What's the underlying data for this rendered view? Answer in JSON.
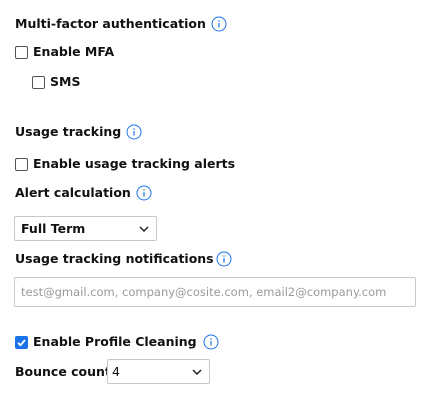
{
  "mfa": {
    "title": "Multi-factor authentication",
    "enable_label": "Enable MFA",
    "enable_checked": false,
    "sms_label": "SMS",
    "sms_checked": false
  },
  "usage": {
    "title": "Usage tracking",
    "alerts_label": "Enable usage tracking alerts",
    "alerts_checked": false,
    "alert_calc_label": "Alert calculation",
    "alert_calc_value": "Full Term",
    "notifications_label": "Usage tracking notifications",
    "notifications_placeholder": "test@gmail.com, company@cosite.com, email2@company.com"
  },
  "profile": {
    "cleaning_label": "Enable Profile Cleaning",
    "cleaning_checked": true,
    "bounce_label": "Bounce count",
    "bounce_value": "4"
  },
  "colors": {
    "accent": "#1a73e8",
    "info_icon": "#1a73e8",
    "text": "#111111",
    "placeholder": "#9a9a9a"
  },
  "icons": {
    "info": "info-circle-icon",
    "chevron": "chevron-down-icon",
    "check": "checkmark-icon"
  }
}
